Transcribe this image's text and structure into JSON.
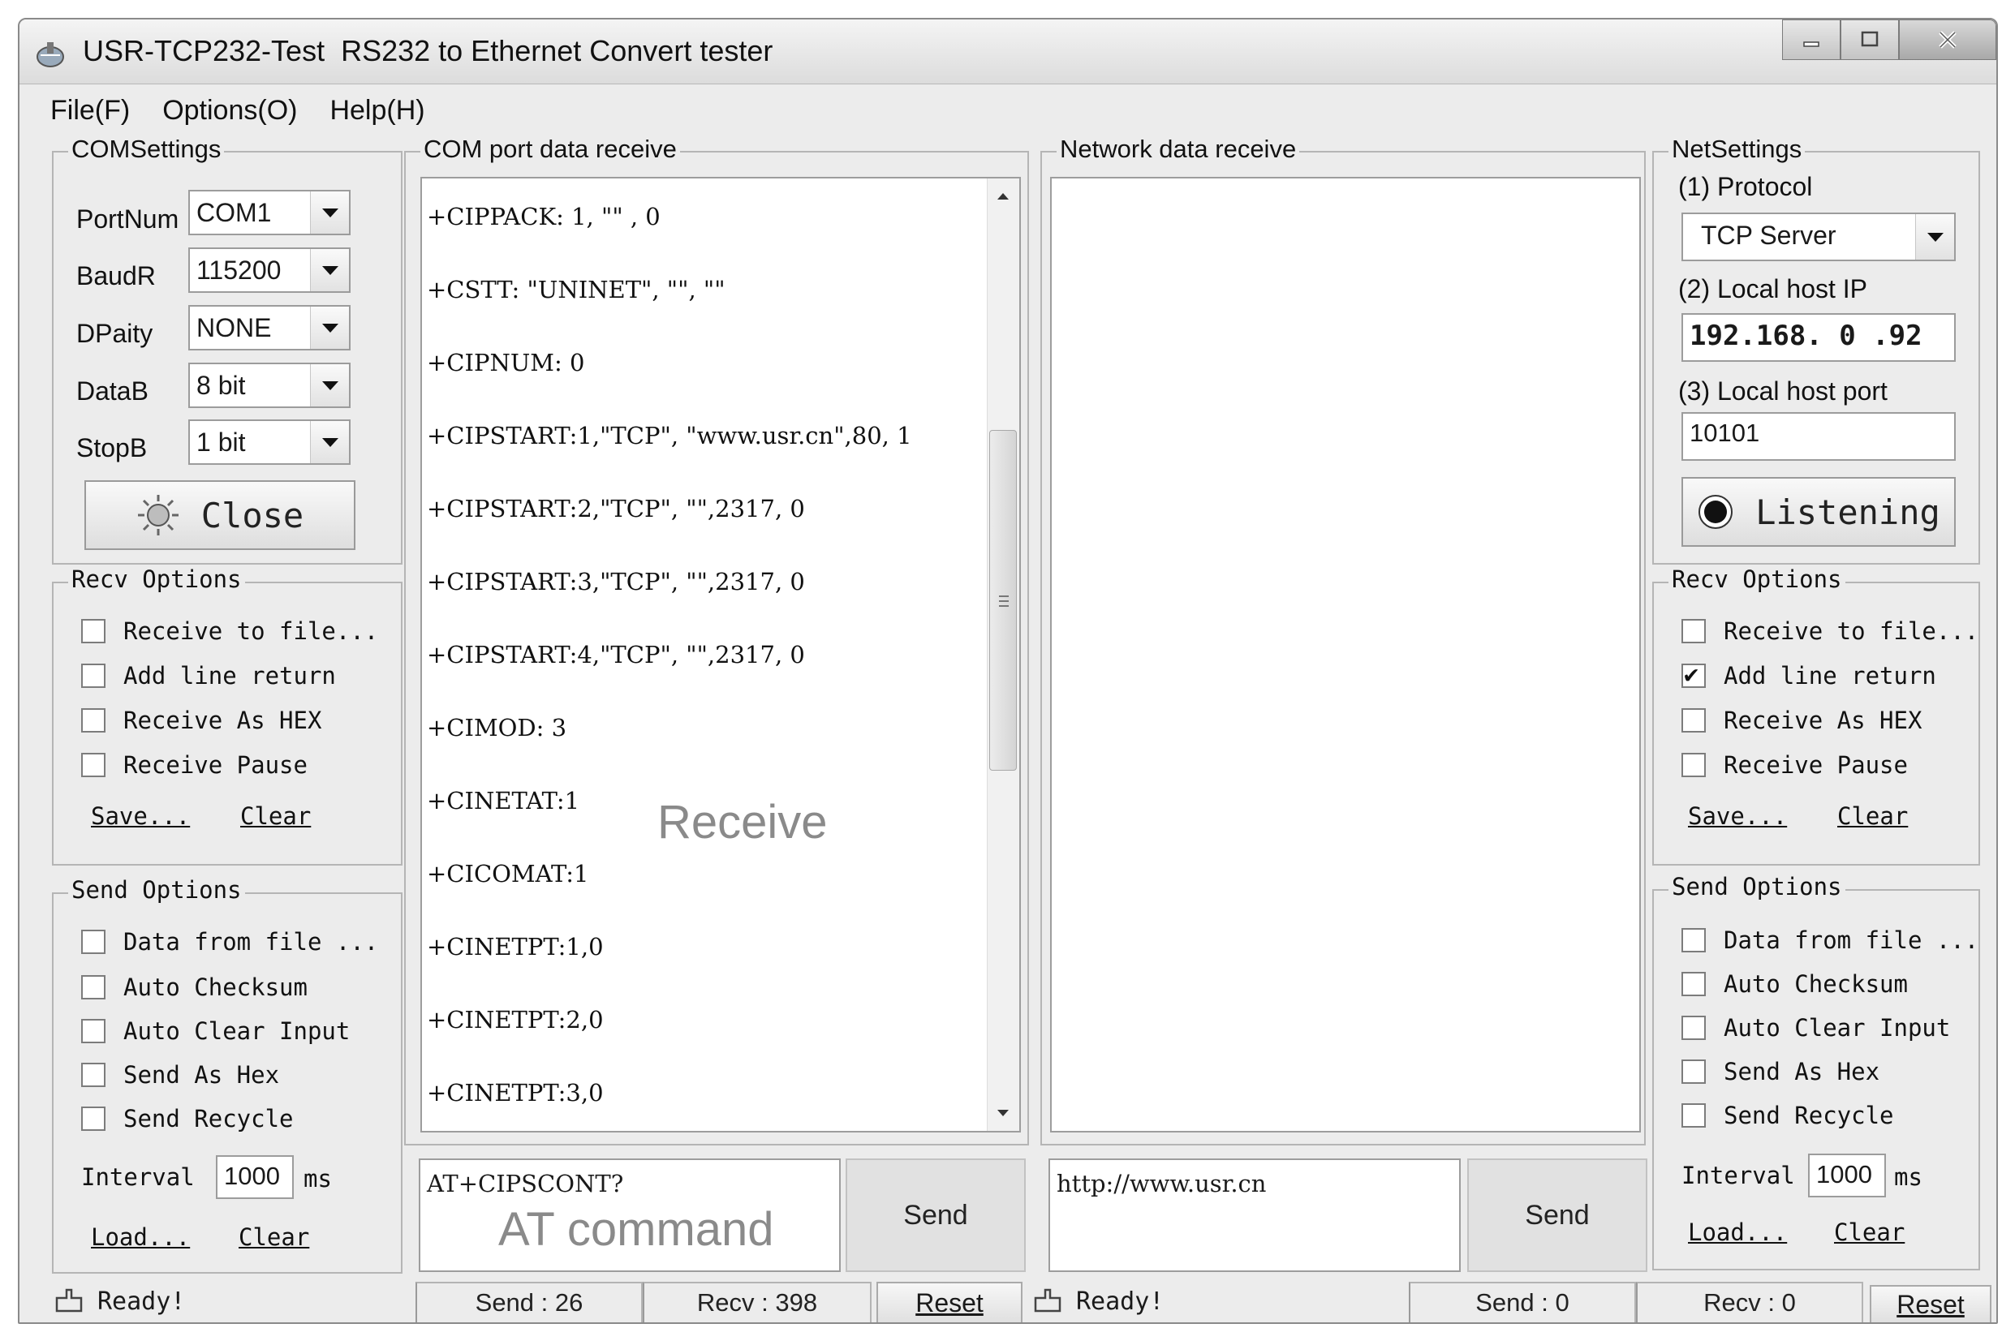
{
  "window": {
    "title": "USR-TCP232-Test  RS232 to Ethernet Convert tester",
    "menu": [
      "File(F)",
      "Options(O)",
      "Help(H)"
    ]
  },
  "com_settings": {
    "title": "COMSettings",
    "fields": [
      {
        "label": "PortNum",
        "value": "COM1"
      },
      {
        "label": "BaudR",
        "value": "115200"
      },
      {
        "label": "DPaity",
        "value": "NONE"
      },
      {
        "label": "DataB",
        "value": "8 bit"
      },
      {
        "label": "StopB",
        "value": "1 bit"
      }
    ],
    "close_button": "Close"
  },
  "com_recv_options": {
    "title": "Recv Options",
    "items": [
      {
        "label": "Receive to file...",
        "checked": false
      },
      {
        "label": "Add line return",
        "checked": false
      },
      {
        "label": "Receive As HEX",
        "checked": false
      },
      {
        "label": "Receive Pause",
        "checked": false
      }
    ],
    "save": "Save...",
    "clear": "Clear"
  },
  "com_send_options": {
    "title": "Send Options",
    "items": [
      {
        "label": "Data from file ...",
        "checked": false
      },
      {
        "label": "Auto Checksum",
        "checked": false
      },
      {
        "label": "Auto Clear Input",
        "checked": false
      },
      {
        "label": "Send As Hex",
        "checked": false
      },
      {
        "label": "Send Recycle",
        "checked": false
      }
    ],
    "interval_label": "Interval",
    "interval_value": "1000",
    "interval_unit": "ms",
    "load": "Load...",
    "clear": "Clear"
  },
  "com_receive": {
    "title": "COM port data receive",
    "lines": [
      "+CIPPACK: 1, \"\" , 0",
      "+CSTT: \"UNINET\", \"\", \"\"",
      "+CIPNUM: 0",
      "+CIPSTART:1,\"TCP\", \"www.usr.cn\",80, 1",
      "+CIPSTART:2,\"TCP\", \"\",2317, 0",
      "+CIPSTART:3,\"TCP\", \"\",2317, 0",
      "+CIPSTART:4,\"TCP\", \"\",2317, 0",
      "+CIMOD: 3",
      "+CINETAT:1",
      "+CICOMAT:1",
      "+CINETPT:1,0",
      "+CINETPT:2,0",
      "+CINETPT:3,0"
    ],
    "overlay_label": "Receive",
    "send_input": "AT+CIPSCONT?",
    "send_overlay": "AT command",
    "send_button": "Send"
  },
  "net_receive": {
    "title": "Network data receive",
    "send_input": "http://www.usr.cn",
    "send_button": "Send"
  },
  "net_settings": {
    "title": "NetSettings",
    "protocol_label": "(1) Protocol",
    "protocol_value": "TCP Server",
    "ip_label": "(2) Local host IP",
    "ip_value": "192.168. 0 .92",
    "port_label": "(3) Local host port",
    "port_value": "10101",
    "listen_button": "Listening"
  },
  "net_recv_options": {
    "title": "Recv Options",
    "items": [
      {
        "label": "Receive to file...",
        "checked": false
      },
      {
        "label": "Add line return",
        "checked": true
      },
      {
        "label": "Receive As HEX",
        "checked": false
      },
      {
        "label": "Receive Pause",
        "checked": false
      }
    ],
    "save": "Save...",
    "clear": "Clear"
  },
  "net_send_options": {
    "title": "Send Options",
    "items": [
      {
        "label": "Data from file ...",
        "checked": false
      },
      {
        "label": "Auto Checksum",
        "checked": false
      },
      {
        "label": "Auto Clear Input",
        "checked": false
      },
      {
        "label": "Send As Hex",
        "checked": false
      },
      {
        "label": "Send Recycle",
        "checked": false
      }
    ],
    "interval_label": "Interval",
    "interval_value": "1000",
    "interval_unit": "ms",
    "load": "Load...",
    "clear": "Clear"
  },
  "status_left": {
    "text": "Ready!",
    "send": "Send : 26",
    "recv": "Recv : 398",
    "reset": "Reset"
  },
  "status_right": {
    "text": "Ready!",
    "send": "Send : 0",
    "recv": "Recv : 0",
    "reset": "Reset"
  }
}
